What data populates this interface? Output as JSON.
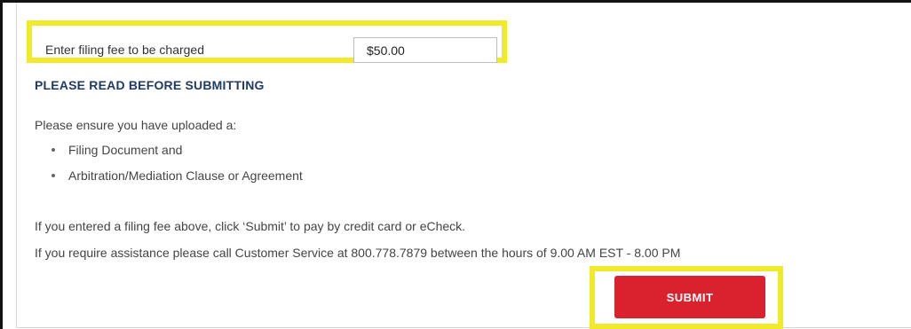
{
  "fee": {
    "label": "Enter filing fee to be charged",
    "value": "$50.00"
  },
  "notice": {
    "heading": "PLEASE READ BEFORE SUBMITTING",
    "intro": "Please ensure you have uploaded a:",
    "items": [
      "Filing Document and",
      "Arbitration/Mediation Clause or Agreement"
    ],
    "pay_text": "If you entered a filing fee above, click ‘Submit’ to pay by credit card or eCheck.",
    "assist_text": "If you require assistance please call Customer Service at 800.778.7879 between the hours of 9.00 AM EST - 8.00 PM"
  },
  "actions": {
    "submit_label": "SUBMIT"
  },
  "colors": {
    "highlight": "#f0ea2b",
    "submit": "#d9222e",
    "heading": "#1f3b64"
  }
}
